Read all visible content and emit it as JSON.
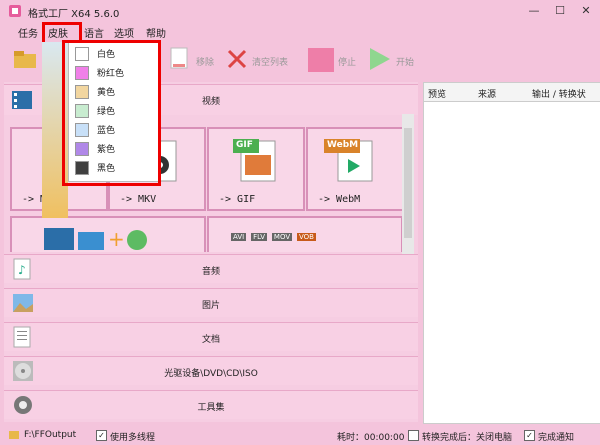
{
  "window": {
    "title": "格式工厂 X64 5.6.0"
  },
  "menubar": {
    "items": [
      "任务",
      "皮肤",
      "语言",
      "选项",
      "帮助"
    ]
  },
  "toolbar": {
    "remove": "移除",
    "clear": "清空列表",
    "stop": "停止",
    "start": "开始"
  },
  "skin_menu": {
    "items": [
      {
        "label": "白色",
        "color": "#ffffff"
      },
      {
        "label": "粉红色",
        "color": "#f080e8"
      },
      {
        "label": "黄色",
        "color": "#f2d6a0"
      },
      {
        "label": "绿色",
        "color": "#c8ecd0"
      },
      {
        "label": "蓝色",
        "color": "#c8e0f8"
      },
      {
        "label": "紫色",
        "color": "#b088e8"
      },
      {
        "label": "黑色",
        "color": "#404040"
      }
    ]
  },
  "left": {
    "video_header": "视频",
    "tiles": [
      "-> MP4",
      "-> MKV",
      "-> GIF",
      "-> WebM"
    ],
    "categories": [
      "音频",
      "图片",
      "文档",
      "光驱设备\\DVD\\CD\\ISO",
      "工具集"
    ],
    "tile_badges": {
      "gif": "GIF",
      "webm": "WebM",
      "formats": [
        "AVI",
        "FLV",
        "MOV",
        "VOB"
      ]
    }
  },
  "right": {
    "columns": [
      "预览",
      "来源",
      "输出 / 转换状"
    ]
  },
  "statusbar": {
    "output_folder": "F:\\FFOutput",
    "multithread": "使用多线程",
    "time_label": "耗时：00:00:00",
    "after_convert": "转换完成后：关闭电脑",
    "notify": "完成通知"
  },
  "colors": {
    "skin_bg": "#f4c4dc",
    "highlight_box": "#ee0000",
    "tile_border": "#d890b8"
  }
}
